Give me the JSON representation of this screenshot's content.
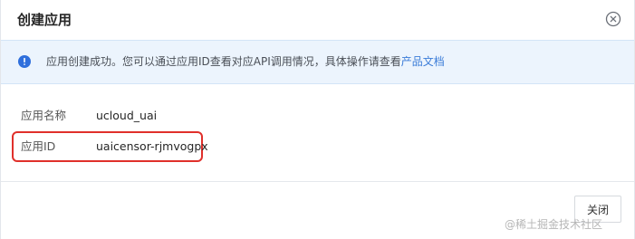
{
  "dialog": {
    "title": "创建应用",
    "close_icon": "close-circle-icon"
  },
  "notice": {
    "icon": "info-icon",
    "accent_color": "#2f6fdc",
    "text": "应用创建成功。您可以通过应用ID查看对应API调用情况，具体操作请查看",
    "link_text": "产品文档"
  },
  "fields": [
    {
      "label": "应用名称",
      "value": "ucloud_uai"
    },
    {
      "label": "应用ID",
      "value": "uaicensor-rjmvogpx"
    }
  ],
  "highlight_color": "#e0302b",
  "footer": {
    "close_label": "关闭"
  },
  "watermark": "@稀土掘金技术社区"
}
